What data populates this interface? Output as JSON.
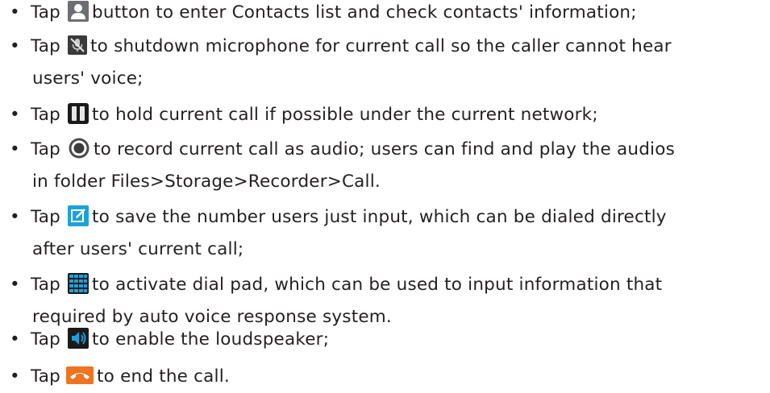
{
  "items": [
    {
      "tap": "Tap",
      "icon": "contacts-icon",
      "line1": "button to enter Contacts list and check contacts' information;",
      "line2": ""
    },
    {
      "tap": "Tap",
      "icon": "mute-microphone-icon",
      "line1": "to shutdown microphone for current call so the caller cannot hear",
      "line2": "users' voice;"
    },
    {
      "tap": "Tap",
      "icon": "hold-icon",
      "line1": "to hold current call if possible under the current network;",
      "line2": ""
    },
    {
      "tap": "Tap",
      "icon": "record-icon",
      "line1": "to record current call as audio; users can find and play the audios",
      "line2": "in folder Files>Storage>Recorder>Call."
    },
    {
      "tap": "Tap",
      "icon": "save-number-icon",
      "line1": "to save the number users just input, which can be dialed directly",
      "line2": "after users' current call;"
    },
    {
      "tap": "Tap",
      "icon": "dial-pad-icon",
      "line1": "to activate dial pad, which can be used to input information that",
      "line2": "required by auto voice response system."
    },
    {
      "tap": "Tap",
      "icon": "loudspeaker-icon",
      "line1": "to enable the loudspeaker;",
      "line2": ""
    },
    {
      "tap": "Tap",
      "icon": "end-call-icon",
      "line1": "to end the call.",
      "line2": ""
    }
  ],
  "bullet": "•",
  "colors": {
    "text": "#231f20",
    "hold_icon": "#1a1a1a",
    "save_icon": "#1ea1d9",
    "dialpad_icon": "#1ea1d9",
    "speaker_icon": "#1ea1d9",
    "end_call_icon": "#ee7422"
  }
}
